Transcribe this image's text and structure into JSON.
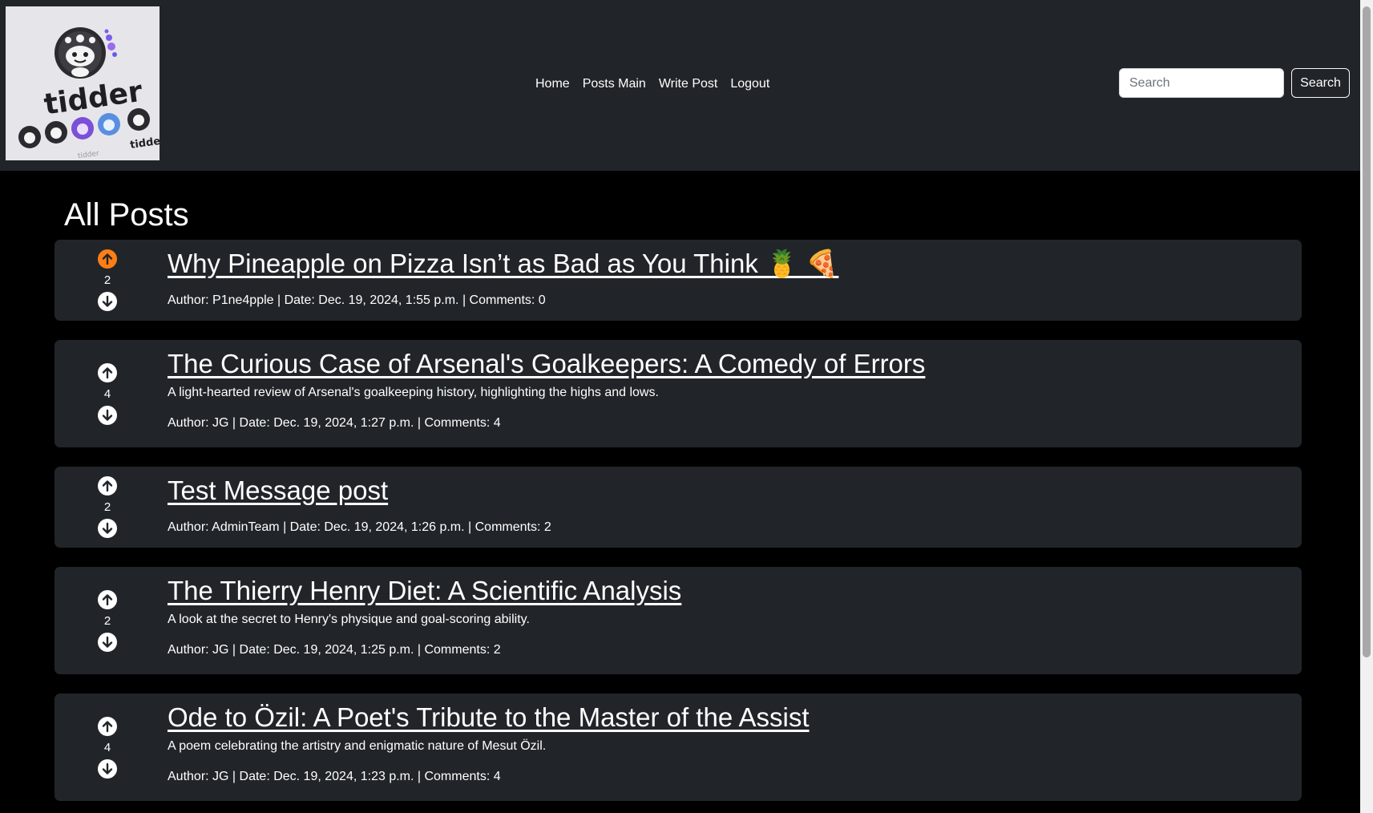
{
  "colors": {
    "navbar_bg": "#212529",
    "page_bg": "#000000",
    "card_bg": "#212529",
    "upvote_active": "#fd7e14",
    "text": "#ffffff"
  },
  "header": {
    "logo_text": "tidder",
    "nav": [
      "Home",
      "Posts Main",
      "Write Post",
      "Logout"
    ],
    "search": {
      "placeholder": "Search",
      "value": "",
      "button_label": "Search"
    }
  },
  "main": {
    "title": "All Posts",
    "posts": [
      {
        "title": "Why Pineapple on Pizza Isn’t as Bad as You Think 🍍 🍕",
        "description": "",
        "votes": "2",
        "upvoted": true,
        "meta": "Author: P1ne4pple | Date: Dec. 19, 2024, 1:55 p.m. | Comments: 0"
      },
      {
        "title": "The Curious Case of Arsenal's Goalkeepers: A Comedy of Errors",
        "description": "A light-hearted review of Arsenal's goalkeeping history, highlighting the highs and lows.",
        "votes": "4",
        "upvoted": false,
        "meta": "Author: JG | Date: Dec. 19, 2024, 1:27 p.m. | Comments: 4"
      },
      {
        "title": "Test Message post",
        "description": "",
        "votes": "2",
        "upvoted": false,
        "meta": "Author: AdminTeam | Date: Dec. 19, 2024, 1:26 p.m. | Comments: 2"
      },
      {
        "title": "The Thierry Henry Diet: A Scientific Analysis",
        "description": "A look at the secret to Henry's physique and goal-scoring ability.",
        "votes": "2",
        "upvoted": false,
        "meta": "Author: JG | Date: Dec. 19, 2024, 1:25 p.m. | Comments: 2"
      },
      {
        "title": "Ode to Özil: A Poet's Tribute to the Master of the Assist",
        "description": "A poem celebrating the artistry and enigmatic nature of Mesut Özil.",
        "votes": "4",
        "upvoted": false,
        "meta": "Author: JG | Date: Dec. 19, 2024, 1:23 p.m. | Comments: 4"
      }
    ]
  },
  "icons": {
    "upvote": "arrow-up-circle-icon",
    "downvote": "arrow-down-circle-icon"
  }
}
